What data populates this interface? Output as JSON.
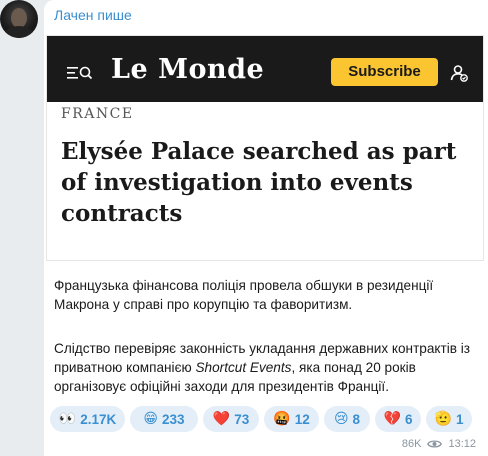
{
  "message": {
    "sender": "Лачен пише"
  },
  "preview": {
    "logo": "Le Monde",
    "subscribe_label": "Subscribe",
    "kicker": "FRANCE",
    "headline": "Elysée Palace searched as part of investigation into events contracts",
    "icons": [
      "menu-search-icon",
      "account-icon"
    ],
    "header_color": "#1a1a1a",
    "subscribe_color": "#fbc531"
  },
  "body": {
    "paragraph1": "Французька фінансова поліція провела обшуки в резиденції Макрона у справі про корупцію та фаворитизм.",
    "paragraph2_before": "Слідство перевіряє законність укладання державних контрактів із приватною компанією ",
    "paragraph2_italic": "Shortcut Events",
    "paragraph2_after": ", яка понад 20 років організовує офіційні заходи для президентів Франції."
  },
  "reactions": [
    {
      "emoji": "👀",
      "icon": "eyes-icon",
      "count": "2.17K"
    },
    {
      "emoji": "😁",
      "icon": "grin-icon",
      "count": "233"
    },
    {
      "emoji": "❤️",
      "icon": "heart-icon",
      "count": "73"
    },
    {
      "emoji": "🤬",
      "icon": "angry-icon",
      "count": "12"
    },
    {
      "emoji": "😢",
      "icon": "cry-icon",
      "count": "8"
    },
    {
      "emoji": "💔",
      "icon": "broken-heart-icon",
      "count": "6"
    },
    {
      "emoji": "🫡",
      "icon": "salute-icon",
      "count": "1"
    }
  ],
  "meta": {
    "views": "86K",
    "time": "13:12"
  },
  "colors": {
    "accent": "#3a8fd0",
    "reaction_bg": "#e4eef8"
  }
}
